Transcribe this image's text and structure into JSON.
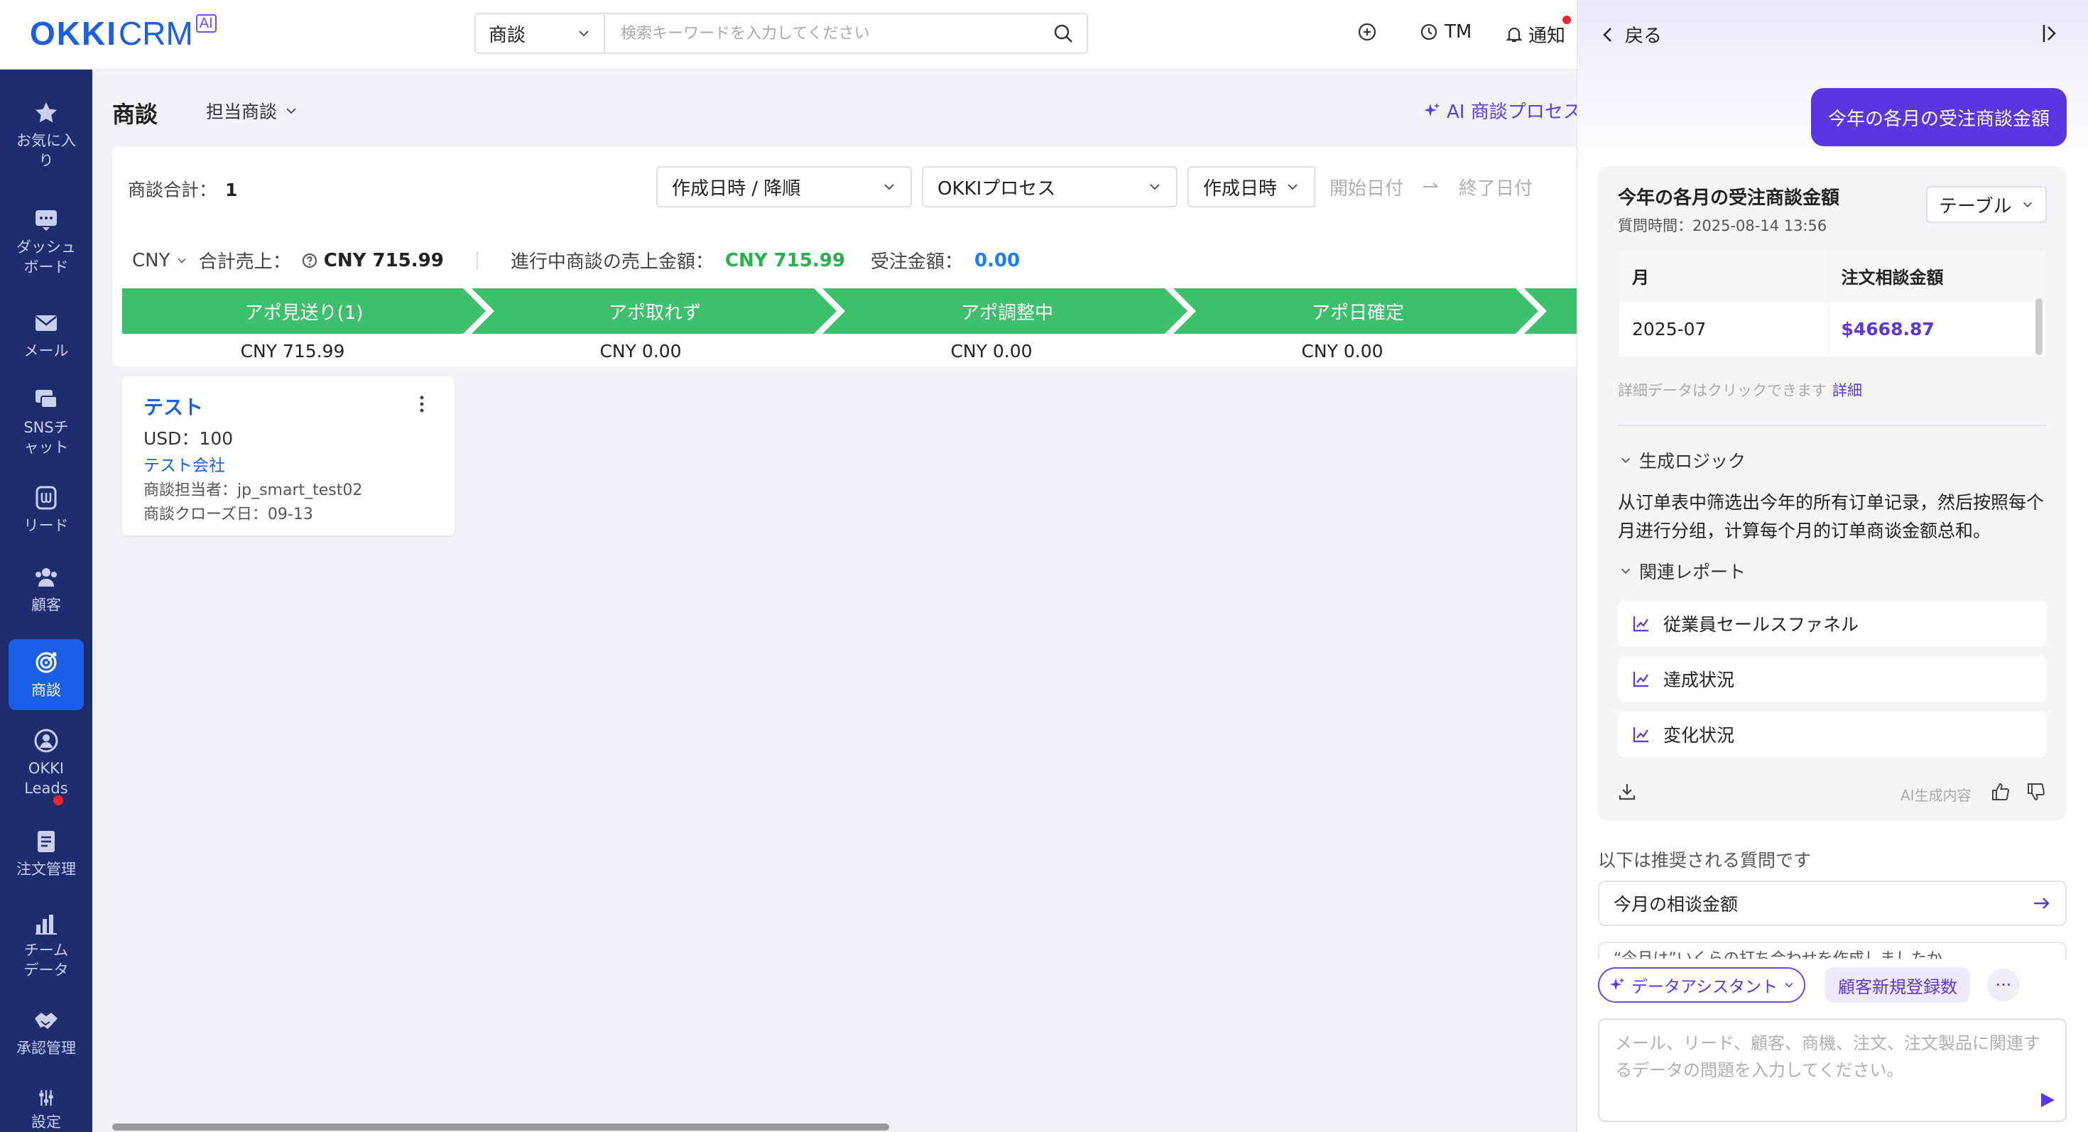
{
  "app": {
    "logo_okki": "OKKI",
    "logo_crm": "CRM",
    "logo_ai": "AI"
  },
  "search": {
    "scope": "商談",
    "placeholder": "検索キーワードを入力してください"
  },
  "topbar": {
    "user": "TM",
    "notify": "通知"
  },
  "sidebar": {
    "items": [
      {
        "label": "お気に入り",
        "icon": "star-icon"
      },
      {
        "label": "ダッシュボード",
        "icon": "dashboard-icon"
      },
      {
        "label": "メール",
        "icon": "mail-icon"
      },
      {
        "label": "SNSチャット",
        "icon": "chat-icon"
      },
      {
        "label": "リード",
        "icon": "lead-icon"
      },
      {
        "label": "顧客",
        "icon": "customers-icon"
      },
      {
        "label": "商談",
        "icon": "target-icon",
        "active": true
      },
      {
        "label": "OKKI Leads",
        "icon": "okki-leads-icon"
      },
      {
        "label": "注文管理",
        "icon": "order-icon"
      },
      {
        "label": "チームデータ",
        "icon": "chart-icon"
      },
      {
        "label": "承認管理",
        "icon": "approval-icon"
      },
      {
        "label": "設定",
        "icon": "settings-icon"
      }
    ]
  },
  "main": {
    "title": "商談",
    "owner_filter": "担当商談",
    "ai_process": "AI 商談プロセス",
    "total_label": "商談合計：",
    "total_value": "1",
    "sort_select": "作成日時 / 降順",
    "process_select": "OKKIプロセス",
    "date_field": "作成日時",
    "date_start": "開始日付",
    "date_end": "終了日付",
    "summary": {
      "currency": "CNY",
      "sales_label": "合計売上：",
      "sales_value": "CNY 715.99",
      "ongoing_label": "進行中商談の売上金額：",
      "ongoing_value": "CNY 715.99",
      "won_label": "受注金額：",
      "won_value": "0.00"
    },
    "stages": [
      {
        "label": "アポ見送り(1)",
        "amount": "CNY 715.99"
      },
      {
        "label": "アポ取れず",
        "amount": "CNY 0.00"
      },
      {
        "label": "アポ調整中",
        "amount": "CNY 0.00"
      },
      {
        "label": "アポ日確定",
        "amount": "CNY 0.00"
      }
    ],
    "deal": {
      "name": "テスト",
      "amount": "USD：100",
      "company": "テスト会社",
      "owner": "商談担当者：jp_smart_test02",
      "close": "商談クローズ日：09-13"
    },
    "colors": {
      "stage_green": "#3dc06c",
      "accent_blue": "#1b5fe6"
    }
  },
  "panel": {
    "back": "戻る",
    "question": "今年の各月の受注商談金額",
    "answer_title": "今年の各月の受注商談金額",
    "answer_time": "質問時間：2025-08-14 13:56",
    "view_select": "テーブル",
    "table": {
      "headers": [
        "月",
        "注文相談金額"
      ],
      "rows": [
        [
          "2025-07",
          "$4668.87"
        ]
      ]
    },
    "detail_hint": "詳細データはクリックできます",
    "detail_link": "詳細",
    "logic_title": "生成ロジック",
    "logic_text": "从订单表中筛选出今年的所有订单记录，然后按照每个月进行分组，计算每个月的订单商谈金额总和。",
    "reports_title": "関連レポート",
    "reports": [
      "従業員セールスファネル",
      "達成状況",
      "変化状況"
    ],
    "ai_generated": "AI生成内容",
    "suggest_title": "以下は推奨される質問です",
    "suggestions": [
      "今月の相谈金额",
      "“今月は”いくらの打ち合わせを作成しましたか"
    ],
    "assistant_chip": "データアシスタント",
    "quick_chip": "顧客新規登録数",
    "more": "···",
    "input_placeholder": "メール、リード、顧客、商機、注文、注文製品に関連するデータの問題を入力してください。",
    "accent": "#5a35e0"
  }
}
